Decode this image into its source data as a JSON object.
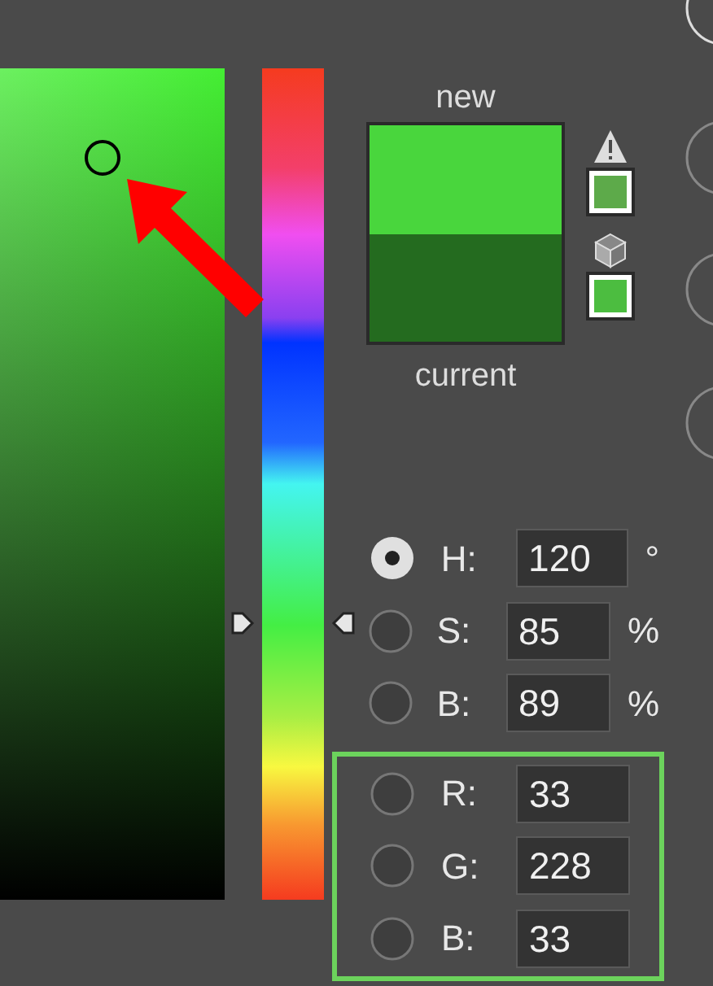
{
  "hue_slider": {
    "level": 0.333
  },
  "swatches": [
    {
      "label": "new",
      "color": "#49d63d"
    },
    {
      "label": "current",
      "color": "#246b1f"
    }
  ],
  "alerts": [
    {
      "kind": "gamut",
      "color": "#5daa4a"
    },
    {
      "kind": "web",
      "color": "#4cbd40"
    }
  ],
  "hsb": {
    "highlighted": false,
    "rows": [
      {
        "label": "H:",
        "value": "120",
        "unit": "°",
        "selected": true
      },
      {
        "label": "S:",
        "value": "85",
        "unit": "%",
        "selected": false
      },
      {
        "label": "B:",
        "value": "89",
        "unit": "%",
        "selected": false
      }
    ]
  },
  "rgb": {
    "highlighted": true,
    "rows": [
      {
        "label": "R:",
        "value": "33",
        "selected": false
      },
      {
        "label": "G:",
        "value": "228",
        "selected": false
      },
      {
        "label": "B:",
        "value": "33",
        "selected": false
      }
    ]
  }
}
